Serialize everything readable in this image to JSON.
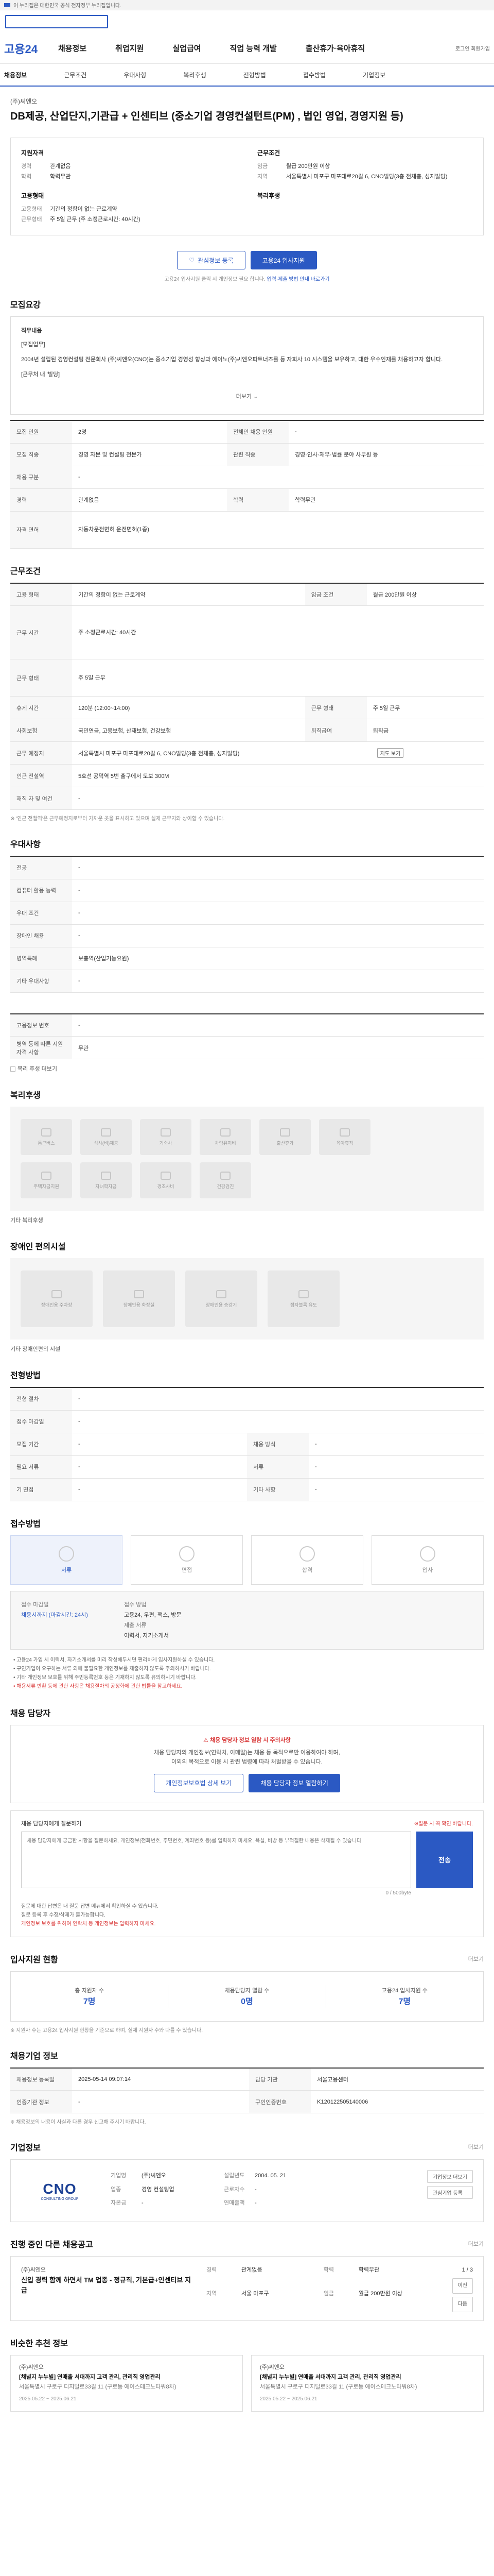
{
  "topbar": {
    "text": "이 누리집은 대한민국 공식 전자정부 누리집입니다."
  },
  "header": {
    "logo": "고용24",
    "menu": [
      "채용정보",
      "취업지원",
      "실업급여",
      "직업 능력 개발",
      "출산휴가·육아휴직"
    ],
    "right": "로그인  회원가입"
  },
  "subnav": [
    "채용정보",
    "근무조건",
    "우대사항",
    "복리후생",
    "전형방법",
    "접수방법",
    "기업정보"
  ],
  "job": {
    "company": "(주)씨엔오",
    "title": "DB제공, 산업단지,기관급 + 인센티브 (중소기업 경영컨설턴트(PM) , 법인 영업, 경영지원 등)"
  },
  "summary": {
    "recruit_title": "지원자격",
    "recruit": [
      {
        "k": "경력",
        "v": "관계없음"
      },
      {
        "k": "학력",
        "v": "학력무관"
      }
    ],
    "work_title": "근무조건",
    "work": [
      {
        "k": "임금",
        "v": "월급 200만원 이상"
      },
      {
        "k": "지역",
        "v": "서울특별시 마포구 마포대로20길 6, CNO빌딩(3층 전체층, 성지빌딩)"
      }
    ],
    "emp_title": "고용형태",
    "emp": [
      {
        "k": "고용형태",
        "v": "기간의 정함이 없는 근로계약"
      },
      {
        "k": "근무형태",
        "v": "주 5일 근무 (주 소정근로시간: 40시간)"
      }
    ],
    "welfare_title": "복리후생",
    "welfare": []
  },
  "actions": {
    "bookmark": "관심정보 등록",
    "apply": "고용24 입사지원",
    "note_pre": "고용24 입사지원 클릭 시 개인정보 필요 합니다.",
    "note_hl": "입력·제출 방법 안내 바로가기"
  },
  "sections": {
    "jobinfo": "모집요강",
    "conditions": "근무조건",
    "preferences": "우대사항",
    "welfare": "복리후생",
    "disability": "장애인 편의시설",
    "process": "전형방법",
    "apply_method": "접수방법",
    "contact": "채용 담당자",
    "stats": "입사지원 현황",
    "manage": "채용기업 정보",
    "company": "기업정보",
    "other": "진행 중인 다른 채용공고",
    "similar": "비슷한 추천 정보"
  },
  "more": "더보기",
  "desc": {
    "head": "직무내용",
    "sub": "[모집업무]",
    "p1": "2004년 설립된 경영컨설팅 전문회사 (주)씨엔오(CNO)는 중소기업 경영성 향상과 에이노(주)씨엔오파트너즈를 등 자회사 10 시스템을 보유하고, 대한 우수인재를 채용하고자 합니다.",
    "p2": "[근무처 내 '빌딩]"
  },
  "table1": [
    {
      "k1": "모집 인원",
      "v1": "2명",
      "k2": "전체인 채용 인원",
      "v2": "-"
    },
    {
      "k1": "모집 직종",
      "v1": "경영 자문 및 컨설팅 전문가",
      "k2": "관련 직종",
      "v2": "경영·인사·재무·법률 분야 사무원 등"
    },
    {
      "k1": "채용 구분",
      "v1": "-",
      "k2": "",
      "v2": ""
    },
    {
      "k1": "경력",
      "v1": "관계없음",
      "k2": "학력",
      "v2": "학력무관"
    },
    {
      "k1": "자격 면허",
      "v1": "자동차운전면허  운전면허(1종)",
      "k2": "",
      "v2": ""
    }
  ],
  "table2": [
    {
      "k1": "고용 형태",
      "v1": "기간의 정함이 없는 근로계약",
      "k2": "임금 조건",
      "v2": "월급 200만원 이상"
    },
    {
      "k1": "근무 시간",
      "v1": "주 소정근로시간: 40시간",
      "k2": "",
      "v2": ""
    },
    {
      "k1": "근무 형태",
      "v1": "주 5일 근무",
      "k2": "",
      "v2": ""
    },
    {
      "k1": "휴게 시간",
      "v1": "120분 (12:00~14:00)",
      "k2": "근무 형태",
      "v2": "주 5일 근무"
    },
    {
      "k1": "사회보험",
      "v1": "국민연금, 고용보험, 산재보험, 건강보험",
      "k2": "퇴직급여",
      "v2": "퇴직금"
    },
    {
      "k1": "근무 예정지",
      "v1": "서울특별시 마포구 마포대로20길 6, CNO빌딩(3층 전체층, 성지빌딩)",
      "k2": "지도 보기",
      "v2": ""
    },
    {
      "k1": "인근 전철역",
      "v1": "5호선 공덕역 5번 출구에서 도보 300M",
      "k2": "",
      "v2": ""
    },
    {
      "k1": "재직 자 및 여건",
      "v1": "-",
      "k2": "",
      "v2": ""
    }
  ],
  "table2_note": "※ '인근 전철역'은 근무예정지로부터 가까운 곳을 표시하고 있으며 실제 근무지와 상이할 수 있습니다.",
  "table3": [
    {
      "k": "전공",
      "v": "-"
    },
    {
      "k": "컴퓨터 활용 능력",
      "v": "-"
    },
    {
      "k": "우대 조건",
      "v": "-"
    },
    {
      "k": "장애인 채용",
      "v": "-"
    },
    {
      "k": "병역특례",
      "v": "보충역(산업기능요원)"
    },
    {
      "k": "기타 우대사항",
      "v": "-"
    }
  ],
  "table4": [
    {
      "k": "고용정보 번호",
      "v": "-"
    },
    {
      "k": "병역 등에 따른 지원자격 사항",
      "v": "무관"
    }
  ],
  "welfare_link": "복리 후생 더보기",
  "welfare_icons": [
    "통근버스",
    "식사(비)제공",
    "기숙사",
    "차량유지비",
    "출산휴가",
    "육아휴직",
    "주택자금지원",
    "자녀학자금",
    "경조사비",
    "건강검진"
  ],
  "welfare_more": "기타 복리후생",
  "disability_icons": [
    "장애인용 주차장",
    "장애인용 화장실",
    "장애인용 승강기",
    "점자블록 유도"
  ],
  "disability_more": "기타 장애인편의 시설",
  "table5": [
    {
      "k1": "전형 절차",
      "v1": "-",
      "k2": "",
      "v2": ""
    },
    {
      "k1": "접수 마감일",
      "v1": "-",
      "k2": "",
      "v2": ""
    },
    {
      "k1": "모집 기간",
      "v1": "-",
      "k2": "채용 방식",
      "v2": "-"
    },
    {
      "k1": "필요 서류",
      "v1": "-",
      "k2": "서류",
      "v2": "-"
    },
    {
      "k1": "기 면접",
      "v1": "-",
      "k2": "기타 사항",
      "v2": "-"
    }
  ],
  "process_steps": [
    "서류",
    "면접",
    "합격",
    "입사"
  ],
  "apply": {
    "l1": "접수 마감일",
    "v1": "채용시까지 (마감시간: 24시)",
    "l2": "접수 방법",
    "v2": "고용24, 우편, 팩스, 방문",
    "l3": "제출 서류",
    "v3": "이력서, 자기소개서"
  },
  "apply_notes": [
    "고용24 가입 시 이력서, 자기소개서를 미리 작성해두시면 편리하게 입사지원하실 수 있습니다.",
    "구인기업이 요구하는 서류 외에 불필요한 개인정보를 제출하지 않도록 주의하시기 바랍니다.",
    "기타 개인정보 보호를 위해 주민등록번호 등은 기재하지 않도록 유의하시기 바랍니다.",
    "채용서류 반환 등에 관한 사항은 채용절차의 공정화에 관한 법률을 참고하세요."
  ],
  "warn": {
    "title": "채용 담당자 정보 열람 시 주의사항",
    "t1": "채용 담당자의 개인정보(연락처, 이메일)는 채용 등 목적으로만 이용하여야 하며,",
    "t2": "이외의 목적으로 이용 시 관련 법령에 따라 처벌받을 수 있습니다.",
    "b1": "개인정보보호법 상세 보기",
    "b2": "채용 담당자 정보 열람하기"
  },
  "inquiry": {
    "title": "채용 담당자에게 질문하기",
    "right": "※질문 시 꼭 확인 바랍니다.",
    "placeholder": "채용 담당자에게 궁금한 사항을 질문하세요. 개인정보(전화번호, 주민번호, 계좌번호 등)를 입력하지 마세요. 욕설, 비방 등 부적절한 내용은 삭제될 수 있습니다.",
    "send": "전송",
    "count": "0 / 500byte",
    "notes": [
      "질문에 대한 답변은 내 질문 답변 메뉴에서 확인하실 수 있습니다.",
      "질문 등록 후 수정/삭제가 불가능합니다."
    ],
    "note_red": "개인정보 보호를 위하여 연락처 등 개인정보는 입력하지 마세요."
  },
  "stats": [
    {
      "label": "총 지원자 수",
      "num": "7명"
    },
    {
      "label": "채용담당자 열람 수",
      "num": "0명"
    },
    {
      "label": "고용24 입사지원 수",
      "num": "7명"
    }
  ],
  "stats_note": "※ 지원자 수는 고용24 입사지원 현황을 기준으로 하며, 실제 지원자 수와 다를 수 있습니다.",
  "manage": [
    {
      "k1": "채용정보 등록일",
      "v1": "2025-05-14 09:07:14",
      "k2": "담당 기관",
      "v2": "서울고용센터"
    },
    {
      "k1": "인증기관 정보",
      "v1": "-",
      "k2": "구인인증번호",
      "v2": "K120122505140006"
    }
  ],
  "manage_note": "※ 채용정보의 내용이 사실과 다른 경우 신고해 주시기 바랍니다.",
  "company": {
    "logo_text": "CNO",
    "logo_sub": "CONSULTING GROUP",
    "rows": [
      {
        "k1": "기업명",
        "v1": "(주)씨엔오",
        "k2": "설립년도",
        "v2": "2004. 05. 21"
      },
      {
        "k1": "업종",
        "v1": "경영 컨설팅업",
        "k2": "근로자수",
        "v2": "-"
      },
      {
        "k1": "자본금",
        "v1": "-",
        "k2": "연매출액",
        "v2": "-"
      }
    ],
    "b1": "기업정보 더보기",
    "b2": "관심기업 등록"
  },
  "other": {
    "co": "(주)씨엔오",
    "title": "신입 경력 함께 하면서 TM 업종 - 정규직, 기본급+인센티브 지급",
    "rows": [
      {
        "k1": "경력",
        "v1": "관계없음",
        "k2": "학력",
        "v2": "학력무관"
      },
      {
        "k1": "지역",
        "v1": "서울 마포구",
        "k2": "임금",
        "v2": "월급 200만원 이상"
      }
    ],
    "page": "1 / 3",
    "prev": "이전",
    "next": "다음"
  },
  "similar": [
    {
      "co": "(주)씨엔오",
      "title": "[채널지 누누빌] 연매출 서대까지 고객 관리, 관리직 영업관리",
      "info": "서울특별시 구로구 디지털로33길 11 (구로동 에이스테크노타워8차)",
      "date": "2025.05.22 ~ 2025.06.21"
    },
    {
      "co": "(주)씨엔오",
      "title": "[채널지 누누빌] 연매출 서대까지 고객 관리, 관리직 영업관리",
      "info": "서울특별시 구로구 디지털로33길 11 (구로동 에이스테크노타워8차)",
      "date": "2025.05.22 ~ 2025.06.21"
    }
  ]
}
